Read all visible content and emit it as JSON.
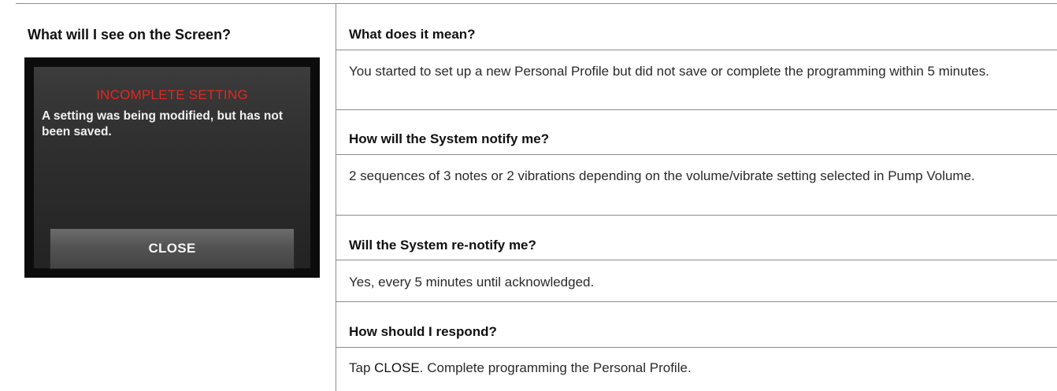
{
  "left": {
    "heading": "What will I see on the Screen?"
  },
  "screen": {
    "alert_title": "INCOMPLETE SETTING",
    "alert_body": "A setting was being modified, but has not been saved.",
    "close_label": "CLOSE",
    "colors": {
      "title": "#e5271f",
      "background": "#2f2f2f",
      "bezel": "#0c0c0c"
    }
  },
  "sections": [
    {
      "heading": "What does it mean?",
      "text": "You started to set up a new Personal Profile but did not save or complete the programming within 5 minutes."
    },
    {
      "heading": "How will the System notify me?",
      "text": "2 sequences of 3 notes or 2 vibrations depending on the volume/vibrate setting selected in Pump Volume."
    },
    {
      "heading": "Will the System re-notify me?",
      "text": "Yes, every 5 minutes until acknowledged."
    },
    {
      "heading": "How should I respond?",
      "text_prefix": "Tap ",
      "text_button": "CLOSE",
      "text_suffix": ". Complete programming the Personal Profile."
    }
  ]
}
